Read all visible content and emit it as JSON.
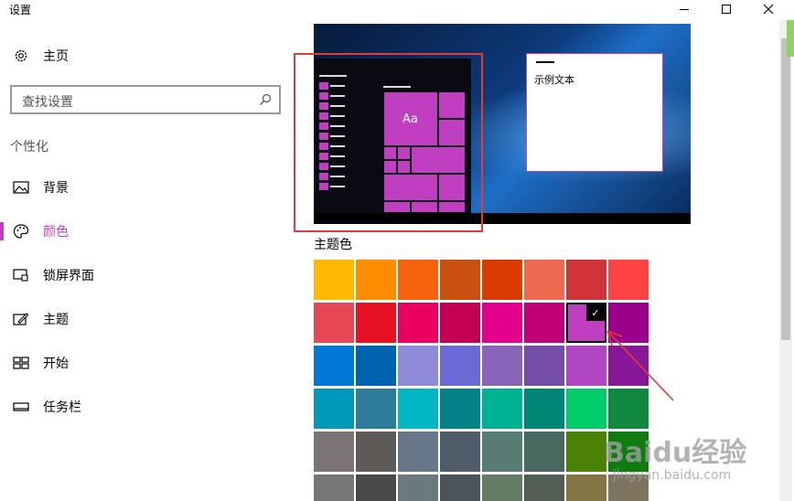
{
  "window": {
    "title": "设置"
  },
  "sidebar": {
    "home_label": "主页",
    "search_placeholder": "查找设置",
    "section": "个性化",
    "items": [
      {
        "label": "背景",
        "icon": "picture-icon"
      },
      {
        "label": "颜色",
        "icon": "palette-icon",
        "active": true
      },
      {
        "label": "锁屏界面",
        "icon": "lockscreen-icon"
      },
      {
        "label": "主题",
        "icon": "theme-brush-icon"
      },
      {
        "label": "开始",
        "icon": "start-grid-icon"
      },
      {
        "label": "任务栏",
        "icon": "taskbar-icon"
      }
    ]
  },
  "preview": {
    "tile_text": "Aa",
    "sample_text": "示例文本"
  },
  "accent": {
    "heading": "主题色",
    "selected_color": "#c03ec0",
    "rows": [
      [
        "#ffb900",
        "#ff8c00",
        "#f7630c",
        "#ca5010",
        "#da3b01",
        "#ef6950",
        "#d13438",
        "#ff4343"
      ],
      [
        "#e74856",
        "#e81123",
        "#ea005e",
        "#c30052",
        "#e3008c",
        "#bf0077",
        "#c03ec0",
        "#9a0089"
      ],
      [
        "#0078d7",
        "#0063b1",
        "#8e8cd8",
        "#6b69d6",
        "#8764b8",
        "#744da9",
        "#b146c2",
        "#881798"
      ],
      [
        "#0099bc",
        "#2d7d9a",
        "#00b7c3",
        "#038387",
        "#00b294",
        "#018574",
        "#00cc6a",
        "#10893e"
      ],
      [
        "#7a7574",
        "#5d5a58",
        "#68768a",
        "#515c6b",
        "#567c73",
        "#486860",
        "#498205",
        "#107c10"
      ],
      [
        "#767676",
        "#4c4a48",
        "#69797e",
        "#4a5459",
        "#647c64",
        "#525e54",
        "#847545",
        "#7e735f"
      ]
    ]
  },
  "watermark": {
    "main": "Baidu经验",
    "sub": "jingyan.baidu.com"
  },
  "colors": {
    "accent": "#c03ec0",
    "annotation": "#e53a3a"
  }
}
